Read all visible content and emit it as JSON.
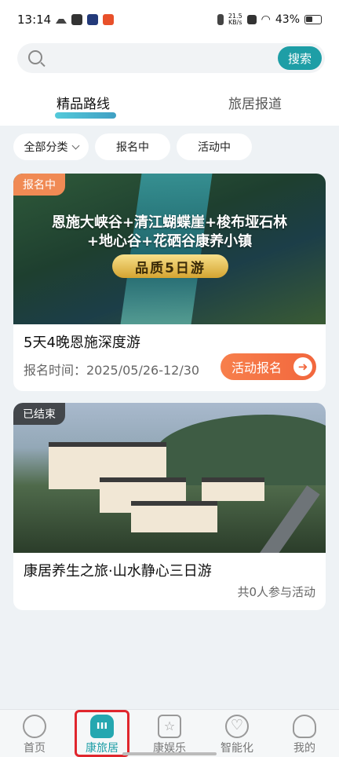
{
  "status_bar": {
    "time": "13:14",
    "speed_value": "21.5",
    "speed_unit": "KB/s",
    "battery": "43%"
  },
  "search": {
    "placeholder": "",
    "button_label": "搜索"
  },
  "tabs": [
    {
      "label": "精品路线",
      "active": true
    },
    {
      "label": "旅居报道",
      "active": false
    }
  ],
  "filters": [
    {
      "label": "全部分类"
    },
    {
      "label": "报名中"
    },
    {
      "label": "活动中"
    }
  ],
  "cards": [
    {
      "badge": "报名中",
      "banner_route_line1": "恩施大峡谷+清江蝴蝶崖+梭布垭石林",
      "banner_route_line2": "+地心谷+花硒谷康养小镇",
      "banner_pill": "品质5日游",
      "title": "5天4晚恩施深度游",
      "date_text": "报名时间：2025/05/26-12/30",
      "action_label": "活动报名"
    },
    {
      "badge": "已结束",
      "title": "康居养生之旅·山水静心三日游",
      "count_text": "共0人参与活动"
    }
  ],
  "nav": [
    {
      "label": "首页",
      "icon": "home-icon"
    },
    {
      "label": "康旅居",
      "icon": "suitcase-icon",
      "active": true
    },
    {
      "label": "康娱乐",
      "icon": "star-icon"
    },
    {
      "label": "智能化",
      "icon": "heart-icon"
    },
    {
      "label": "我的",
      "icon": "user-icon"
    }
  ],
  "colors": {
    "accent": "#1e9ea6",
    "action": "#f2673d",
    "badge_orange": "#f08a54",
    "highlight": "#e0262d"
  }
}
